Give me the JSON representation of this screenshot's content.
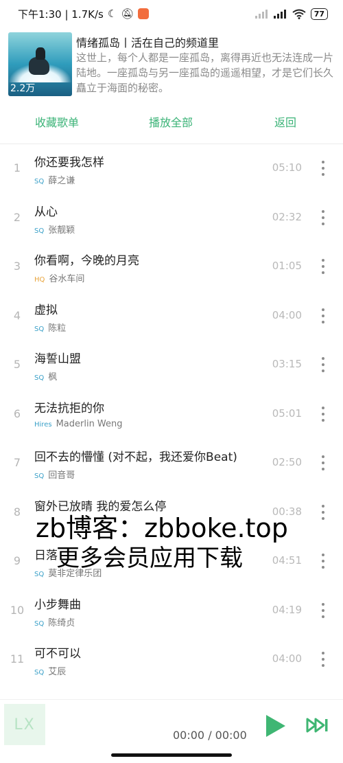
{
  "status_bar": {
    "time_speed": "下午1:30 | 1.7K/s",
    "battery": "77"
  },
  "playlist": {
    "play_count": "2.2万",
    "title": "情绪孤岛丨活在自己的频道里",
    "description": "这世上，每个人都是一座孤岛，离得再近也无法连成一片陆地。一座孤岛与另一座孤岛的遥遥相望，才是它们长久矗立于海面的秘密。"
  },
  "actions": {
    "collect": "收藏歌单",
    "play_all": "播放全部",
    "back": "返回"
  },
  "songs": [
    {
      "num": "1",
      "name": "你还要我怎样",
      "quality": "SQ",
      "artist": "薛之谦",
      "duration": "05:10"
    },
    {
      "num": "2",
      "name": "从心",
      "quality": "SQ",
      "artist": "张靓颖",
      "duration": "02:32"
    },
    {
      "num": "3",
      "name": "你看啊，今晚的月亮",
      "quality": "HQ",
      "artist": "谷水车间",
      "duration": "01:05"
    },
    {
      "num": "4",
      "name": "虚拟",
      "quality": "SQ",
      "artist": "陈粒",
      "duration": "04:00"
    },
    {
      "num": "5",
      "name": "海誓山盟",
      "quality": "SQ",
      "artist": "枫",
      "duration": "03:15"
    },
    {
      "num": "6",
      "name": "无法抗拒的你",
      "quality": "Hires",
      "artist": "Maderlin Weng",
      "duration": "05:01"
    },
    {
      "num": "7",
      "name": "回不去的懵懂 (对不起，我还爱你Beat)",
      "quality": "SQ",
      "artist": "回音哥",
      "duration": "02:50"
    },
    {
      "num": "8",
      "name": "窗外已放晴 我的爱怎么停",
      "quality": "",
      "artist": "",
      "duration": "00:38"
    },
    {
      "num": "9",
      "name": "日落",
      "quality": "SQ",
      "artist": "莫非定律乐团",
      "duration": "04:51"
    },
    {
      "num": "10",
      "name": "小步舞曲",
      "quality": "SQ",
      "artist": "陈绮贞",
      "duration": "04:19"
    },
    {
      "num": "11",
      "name": "可不可以",
      "quality": "SQ",
      "artist": "艾辰",
      "duration": "04:00"
    }
  ],
  "watermark": {
    "line1": "zb博客：zbboke.top",
    "line2": "更多会员应用下载"
  },
  "player": {
    "avatar_text": "LX",
    "time": "00:00 / 00:00"
  }
}
